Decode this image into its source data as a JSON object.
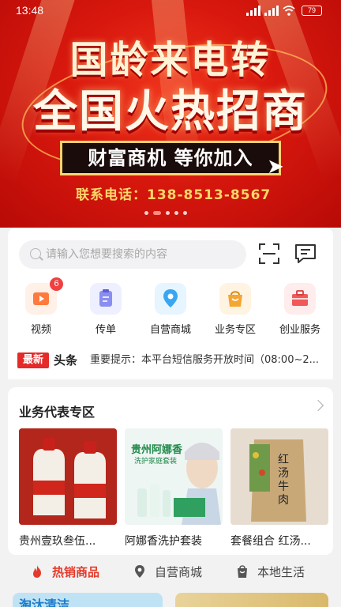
{
  "status_bar": {
    "time": "13:48",
    "battery": "79"
  },
  "banner": {
    "line1": "国龄来电转",
    "line2": "全国火热招商",
    "box_text": "财富商机 等你加入",
    "phone": "联系电话：138-8513-8567"
  },
  "search": {
    "placeholder": "请输入您想要搜索的内容"
  },
  "quick_nav": [
    {
      "label": "视频",
      "badge": "6",
      "color": "#ff7a3d"
    },
    {
      "label": "传单",
      "color": "#7b7fe8"
    },
    {
      "label": "自营商城",
      "color": "#3aa6f0"
    },
    {
      "label": "业务专区",
      "color": "#f5a532"
    },
    {
      "label": "创业服务",
      "color": "#f05a5a"
    }
  ],
  "news": {
    "tag": "最新",
    "tag2": "头条",
    "text": "重要提示：本平台短信服务开放时间（08:00~2..."
  },
  "business": {
    "title": "业务代表专区",
    "products": [
      {
        "name": "贵州壹玖叁伍..."
      },
      {
        "name": "阿娜香洗护套装",
        "img_title": "贵州阿娜香",
        "img_sub": "洗护家庭套装"
      },
      {
        "name": "套餐组合 红汤...",
        "img_text": "红汤牛肉"
      }
    ]
  },
  "tabs": [
    {
      "label": "热销商品",
      "active": true
    },
    {
      "label": "自营商城",
      "active": false
    },
    {
      "label": "本地生活",
      "active": false
    }
  ],
  "peek": {
    "left_text": "淘汰清洁"
  }
}
